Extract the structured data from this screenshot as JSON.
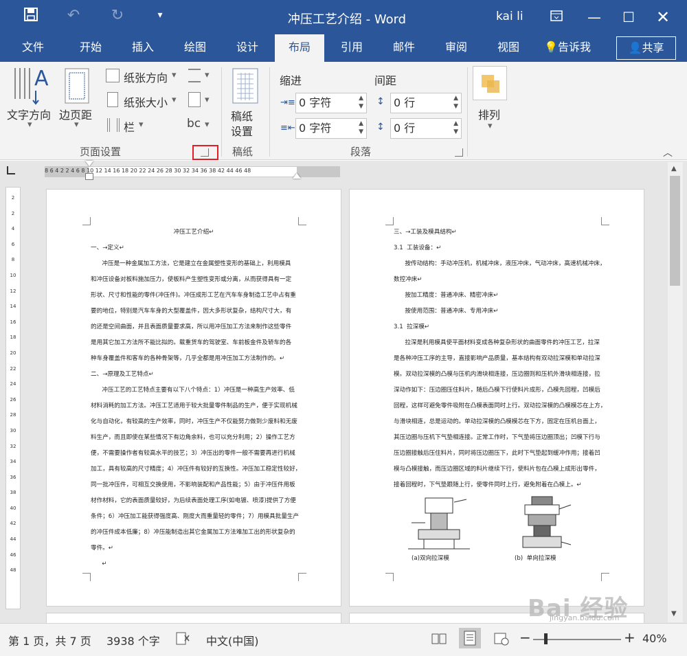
{
  "window": {
    "title": "冲压工艺介绍  -  Word",
    "user": "kai li",
    "tell_me": "告诉我",
    "share": "共享"
  },
  "tabs": [
    "文件",
    "开始",
    "插入",
    "绘图",
    "设计",
    "布局",
    "引用",
    "邮件",
    "审阅",
    "视图"
  ],
  "active_tab": "布局",
  "ribbon": {
    "text_direction": "文字方向",
    "margins": "边页距",
    "orientation": "纸张方向",
    "size": "纸张大小",
    "columns": "栏",
    "group_page_setup": "页面设置",
    "manuscript_setup_1": "稿纸",
    "manuscript_setup_2": "设置",
    "group_manuscript": "稿纸",
    "indent": "缩进",
    "spacing": "间距",
    "indent_left": "0 字符",
    "indent_right": "0 字符",
    "spacing_before": "0 行",
    "spacing_after": "0 行",
    "group_paragraph": "段落",
    "arrange": "排列"
  },
  "ruler_numbers": "8   6   4   2       2   4   6   8  10  12  14  16  18  20  22  24  26  28  30  32  34  36  38        42  44  46  48",
  "vruler_numbers": [
    "2",
    "2",
    "4",
    "6",
    "8",
    "10",
    "12",
    "14",
    "16",
    "18",
    "20",
    "22",
    "24",
    "26",
    "28",
    "30",
    "32",
    "34",
    "36",
    "38",
    "40",
    "42",
    "44",
    "46",
    "48"
  ],
  "page1": {
    "title": "冲压工艺介绍↵",
    "text": "一、→定义↵\n      冲压是一种金属加工方法，它是建立在金属塑性变形的基础上，利用模具\n和冲压设备对板料施加压力，使板料产生塑性变形或分离，从而获得具有一定\n形状、尺寸和性能的零件(冲压件)。冲压成形工艺在汽车车身制造工艺中占有重\n要的地位，特别是汽车车身的大型覆盖件，因大多形状复杂，结构尺寸大，有\n的还是空间曲面，并且表面质量要求高，所以用冲压加工方法来制作这些零件\n是用其它加工方法所不能比拟的。载重货车的驾驶室、车前板金件及轿车的各\n种车身覆盖件和客车的各种骨架等，几乎全都是用冲压加工方法制作的。↵\n二、→原理及工艺特点↵\n      冲压工艺的工艺特点主要有以下八个特点：1）冲压是一种高生产效率、低\n材料消耗的加工方法。冲压工艺适用于较大批量零件制品的生产，便于实现机械\n化与自动化，有较高的生产效率，同时，冲压生产不仅能努力做到少废料和无废\n料生产，而且即使在某些情况下有边角余料，也可以充分利用；2）操作工艺方\n便，不需要操作者有较高水平的技艺；3）冲压出的零件一般不需要再进行机械\n加工，具有较高的尺寸精度；4）冲压件有较好的互换性。冲压加工稳定性较好，\n同一批冲压件，可相互交换使用，不影响装配和产品性能；5）由于冲压件用板\n材作材料，它的表面质量较好，为后续表面处理工序(如电镀、喷漆)提供了方便\n条件；6）冲压加工能获得强度高、刚度大而重量轻的零件；7）用模具批量生产\n的冲压件成本低廉；8）冲压能制造出其它金属加工方法难加工出的形状复杂的\n零件。↵\n      ↵"
  },
  "page2": {
    "text": "三、→工装及模具结构↵\n3.1  工装设备：↵\n      按传动结构：手动冲压机，机械冲床，液压冲床，气动冲床，高速机械冲床，\n数控冲床↵\n      按加工精度：普通冲床、精密冲床↵\n      按使用范围：普通冲床、专用冲床↵\n3.1  拉深模↵\n      拉深是利用模具使平面材料变成各种复杂形状的曲面零件的冲压工艺，拉深\n是各种冲压工序的主导，直接影响产品质量，基本结构有双动拉深模和单动拉深\n模。双动拉深模的凸模与压机内滑块相连接，压边圈则和压机外滑块相连接，拉\n深动作如下：压边圈压住料片，随后凸模下行使料片成形，凸模先回程，凹模后\n回程，这样可避免零件吸附在凸模表面同时上行。双动拉深模的凸模模芯在上方，\n与滑块相连，总是运动的。单动拉深模的凸模模芯在下方，固定在压机台面上，\n其压边圈与压机下气垫相连接。正常工作时，下气垫将压边圈顶出；凹模下行与\n压边圈接触后压住料片，同时将压边圈压下，此时下气垫起到缓冲作用；接着凹\n模与凸模接触，而压边圈区域的料片继续下行，使料片包在凸模上成形出零件，\n接着回程时，下气垫跟随上行，使零件同时上行，避免附着在凸模上。↵",
    "caption_a": "(a)双向拉深模",
    "caption_b": "(b)  单向拉深模"
  },
  "status": {
    "page": "第 1 页，共 7 页",
    "words": "3938 个字",
    "language": "中文(中国)",
    "zoom": "40%"
  },
  "watermark": "Bai 经验",
  "watermark_url": "jingyan.baidu.com"
}
